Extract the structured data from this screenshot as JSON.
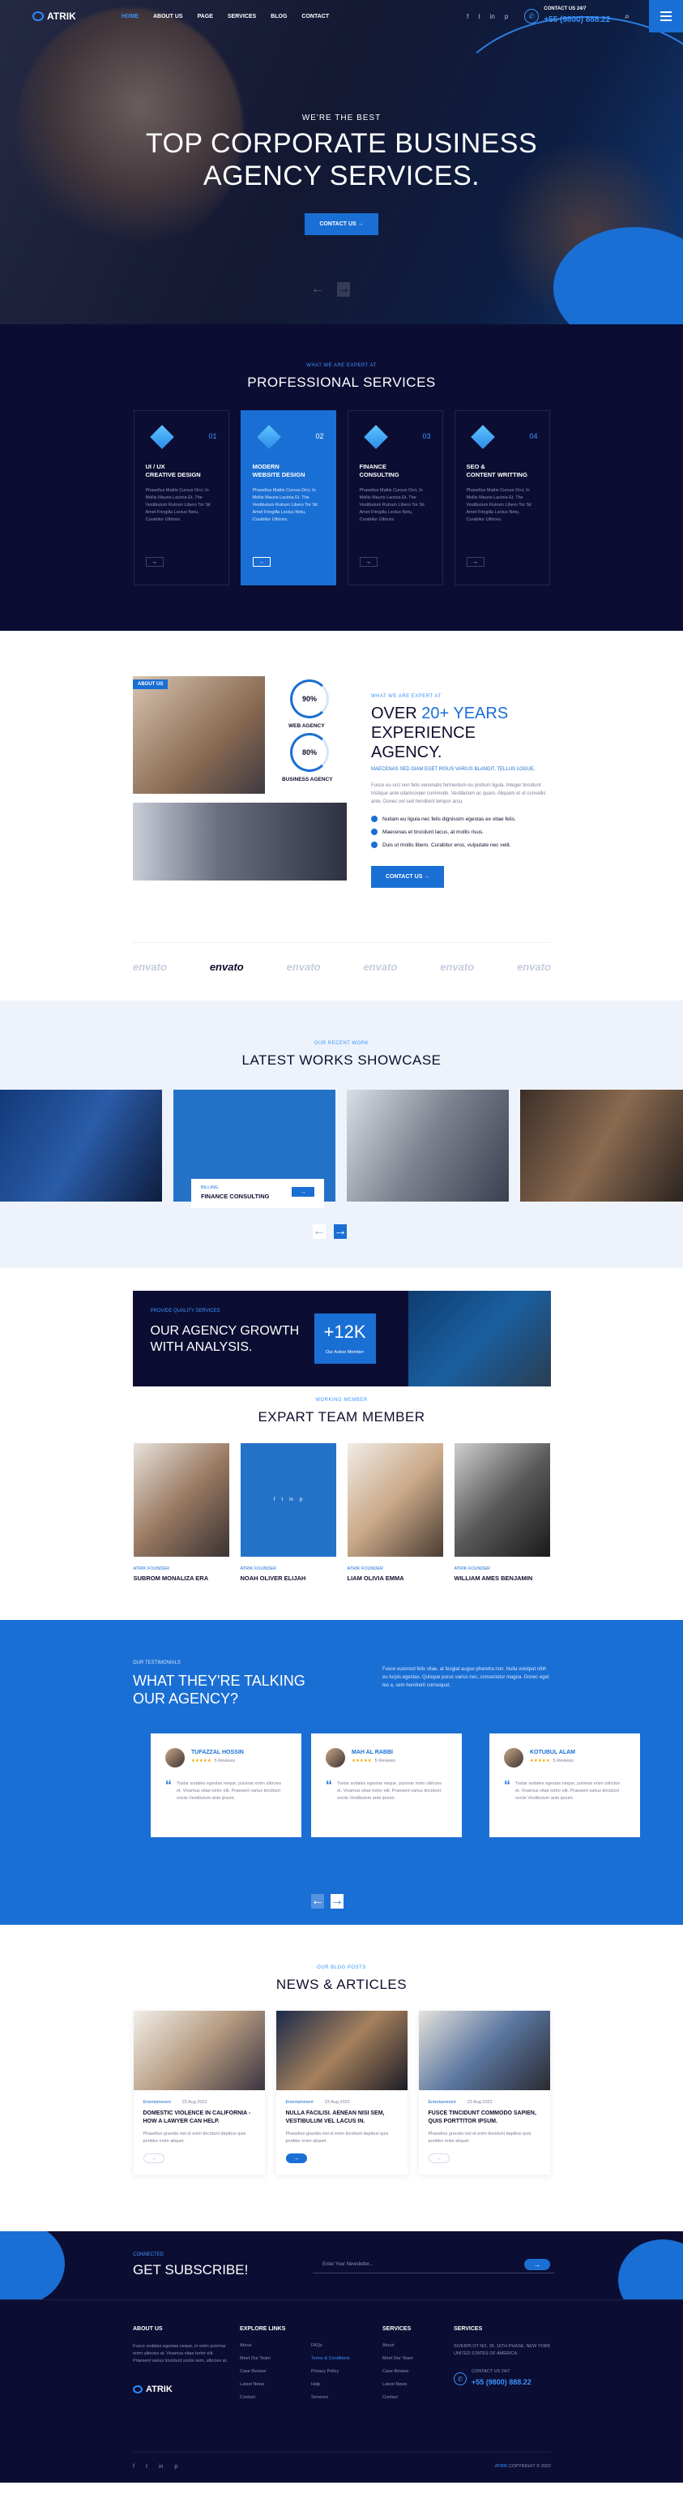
{
  "header": {
    "logo": "ATRIK",
    "menu": [
      "HOME",
      "ABOUT US",
      "PAGE",
      "SERVICES",
      "BLOG",
      "CONTACT"
    ],
    "socials": [
      "f",
      "t",
      "in",
      "p"
    ],
    "contact_label": "CONTACT US 24/7",
    "phone": "+55 (9800) 888.22"
  },
  "hero": {
    "kicker": "WE'RE THE BEST",
    "title_line1": "TOP CORPORATE BUSINESS",
    "title_line2": "AGENCY SERVICES.",
    "cta": "CONTACT US →",
    "prev": "←",
    "next": "→"
  },
  "services": {
    "kicker": "WHAT WE ARE EXPERT AT",
    "title": "PROFESSIONAL SERVICES",
    "items": [
      {
        "num": "01",
        "title_line1": "UI / UX",
        "title_line2": "CREATIVE DESIGN",
        "text": "Phasellus Mattis Cursus Orci, In Mollis Mauris Lacinia Et. The Vestibulum Rutrum Libero Tor Sit Amet Fringilla Lectus Netu, Curabitur Ultrices.",
        "arrow": "→"
      },
      {
        "num": "02",
        "title_line1": "MODERN",
        "title_line2": "WEBSITE DESIGN",
        "text": "Phasellus Mattis Cursus Orci, In Mollis Mauris Lacinia Et. The Vestibulum Rutrum Libero Tor Sit Amet Fringilla Lectus Netu, Curabitur Ultrices.",
        "arrow": "→"
      },
      {
        "num": "03",
        "title_line1": "FINANCE",
        "title_line2": "CONSULTING",
        "text": "Phasellus Mattis Cursus Orci, In Mollis Mauris Lacinia Et. The Vestibulum Rutrum Libero Tor Sit Amet Fringilla Lectus Netu, Curabitur Ultrices.",
        "arrow": "→"
      },
      {
        "num": "04",
        "title_line1": "SEO &",
        "title_line2": "CONTENT WRITTING",
        "text": "Phasellus Mattis Cursus Orci, In Mollis Mauris Lacinia Et. The Vestibulum Rutrum Libero Tor Sit Amet Fringilla Lectus Netu, Curabitur Ultrices.",
        "arrow": "→"
      }
    ]
  },
  "about": {
    "badge": "ABOUT US",
    "stat1_value": "90%",
    "stat1_label": "WEB AGENCY",
    "stat2_value": "80%",
    "stat2_label": "BUSINESS AGENCY",
    "kicker": "WHAT WE ARE EXPERT AT",
    "title_line1": "OVER",
    "title_highlight": "20+ YEARS",
    "title_line2": "EXPERIENCE AGENCY.",
    "subtitle": "MAECENAS SED DIAM EGET RISUS VARIUS BLANDIT, TELLUS LOGUE.",
    "paragraph": "Fusce eu orci non felis venenatis fermentum eu pretium ligula. Integer tincidunt tristique ante ullamcorper commodo. Vestibulum ac quam. Aliquam et ut convallis ante. Donec vel sed hendrerit tempor arcu.",
    "checks": [
      "Nullam eu ligula nec felis dignissim egestas ex vitae felis.",
      "Maecenas et tincidunt lacus, at mollis risus.",
      "Duis ut mollis libero. Curabitur eros, vulputate nec velit."
    ],
    "cta": "CONTACT US →",
    "brands": [
      "envato",
      "envato",
      "envato",
      "envato",
      "envato",
      "envato"
    ]
  },
  "works": {
    "kicker": "OUR RECENT WORK",
    "title": "LATEST WORKS SHOWCASE",
    "card_category": "BILLING",
    "card_title": "FINANCE CONSULTING",
    "card_arrow": "→",
    "prev": "←",
    "next": "→"
  },
  "growth": {
    "kicker": "PROVIDE QUALITY SERVICES",
    "title_line1": "OUR AGENCY GROWTH",
    "title_line2": "WITH ANALYSIS.",
    "count": "+12K",
    "count_label": "Our Active Member"
  },
  "team": {
    "kicker": "WORKING MEMBER",
    "title": "EXPART TEAM MEMBER",
    "members": [
      {
        "role": "ATRIK FOUNDER",
        "name": "SUBROM MONALIZA ERA"
      },
      {
        "role": "ATRIK FOUNDER",
        "name": "NOAH OLIVER ELIJAH"
      },
      {
        "role": "ATRIK FOUNDER",
        "name": "LIAM OLIVIA EMMA"
      },
      {
        "role": "ATRIK FOUNDER",
        "name": "WILLIAM AMES BENJAMIN"
      }
    ],
    "hover_socials": [
      "f",
      "t",
      "in",
      "p"
    ]
  },
  "testimonials": {
    "kicker": "OUR TESTIMONIALS",
    "title_line1": "WHAT THEY'RE TALKING",
    "title_line2": "OUR AGENCY?",
    "paragraph": "Fusce euismod felis vitae, at feugiat augue pharetra non. Nulla volutpat nibh eu turpis egestas. Quisque purus varius nec, consectetur magna. Donec eget leo a, sem hendrerit consequat.",
    "items": [
      {
        "name": "TUFAZZAL HOSSIN",
        "stars": "★★★★★",
        "reviews": "5 Reviews",
        "text": "Tostar sodales egestas neque, pulvinar enim ultricies et. Vivamus vitae tortor elit. Praesent varius tincidunt sociis Vestibulum ante ipsum."
      },
      {
        "name": "MAH AL RABBI",
        "stars": "★★★★★",
        "reviews": "5 Reviews",
        "text": "Tostar sodales egestas neque, pulvinar enim ultricies et. Vivamus vitae tortor elit. Praesent varius tincidunt sociis Vestibulum ante ipsum."
      },
      {
        "name": "KOTUBUL ALAM",
        "stars": "★★★★★",
        "reviews": "5 Reviews",
        "text": "Tostar sodales egestas neque, pulvinar enim ultricies et. Vivamus vitae tortor elit. Praesent varius tincidunt sociis Vestibulum ante ipsum."
      }
    ],
    "prev": "←",
    "next": "→"
  },
  "news": {
    "kicker": "OUR BLOG POSTS",
    "title": "NEWS & ARTICLES",
    "posts": [
      {
        "category": "Entertainment",
        "date": "23 Aug 2022",
        "title_line1": "DOMESTIC VIOLENCE IN CALIFORNIA -",
        "title_line2": "HOW A LAWYER CAN HELP.",
        "text": "Phasellus gravida nisl id enim tincidunt dapibus quis porttitor enim aliquet.",
        "arrow": "→"
      },
      {
        "category": "Entertainment",
        "date": "23 Aug 2022",
        "title_line1": "NULLA FACILISI. AENEAN NISI SEM,",
        "title_line2": "VESTIBULUM VEL LACUS IN.",
        "text": "Phasellus gravida nisl id enim tincidunt dapibus quis porttitor enim aliquet.",
        "arrow": "→"
      },
      {
        "category": "Entertainment",
        "date": "23 Aug 2022",
        "title_line1": "FUSCE TINCIDUNT COMMODO SAPIEN,",
        "title_line2": "QUIS PORTTITOR IPSUM.",
        "text": "Phasellus gravida nisl id enim tincidunt dapibus quis porttitor enim aliquet.",
        "arrow": "→"
      }
    ]
  },
  "subscribe": {
    "kicker": "CONNECTED",
    "title": "GET SUBSCRIBE!",
    "placeholder": "Enter Your Newsletter...",
    "button": "→"
  },
  "footer": {
    "about_title": "ABOUT US",
    "about_text": "Fusce sodales egestas neque, in enim pulvinar enim ultricies at. Vivamus vitae tortor elit. Praesent varius tincidunt sociis sem, ultricies at.",
    "logo": "ATRIK",
    "explore_title": "EXPLORE LINKS",
    "explore_links": [
      "About",
      "Meet Our Team",
      "Case Review",
      "Latest News",
      "Contact"
    ],
    "services_title": "SERVICES",
    "services_links": [
      "FAQs",
      "Terms & Conditions",
      "Privacy Policy",
      "Help",
      "Services"
    ],
    "links_col": [
      "About",
      "Meet Our Team",
      "Case Review",
      "Latest News",
      "Contact"
    ],
    "contact_title": "SERVICES",
    "address": "SIVERPLOT NO. 36, 16TH PHASE, NEW YORK UNITED STATES OF AMERICA.",
    "contact_label": "CONTACT US 24/7",
    "phone": "+55 (9800) 888.22",
    "socials": [
      "f",
      "t",
      "in",
      "p"
    ],
    "copyright_brand": "ATRIK",
    "copyright": "COPYRIGHT © 2022"
  },
  "colors": {
    "accent": "#1a6fd4",
    "dark": "#0c0d32",
    "text": "#0d0e2c"
  }
}
